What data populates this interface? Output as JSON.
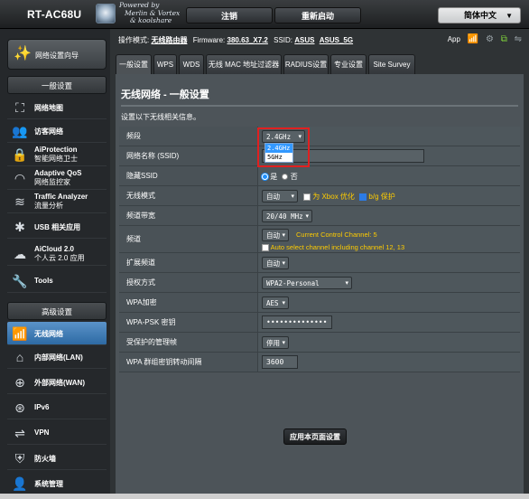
{
  "header": {
    "model": "RT-AC68U",
    "powered_line1": "Powered by",
    "powered_line2": "Merlin & Vortex",
    "powered_line3": "& koolshare",
    "logout": "注销",
    "reboot": "重新启动",
    "language": "简体中文"
  },
  "sidebar": {
    "qis_label": "网络设置向导",
    "general_header": "一般设置",
    "general_items": [
      {
        "label": "网络地图",
        "icon": "network-map-icon"
      },
      {
        "label": "访客网络",
        "icon": "guest-network-icon"
      },
      {
        "label": "AiProtection",
        "sub": "智能网络卫士",
        "icon": "aiprotection-icon"
      },
      {
        "label": "Adaptive QoS",
        "sub": "网络监控家",
        "icon": "qos-icon"
      },
      {
        "label": "Traffic Analyzer",
        "sub": "流量分析",
        "icon": "traffic-analyzer-icon"
      },
      {
        "label": "USB 相关应用",
        "icon": "usb-icon"
      },
      {
        "label": "AiCloud 2.0",
        "sub": "个人云 2.0 应用",
        "icon": "cloud-icon"
      },
      {
        "label": "Tools",
        "icon": "tools-icon"
      }
    ],
    "advanced_header": "高级设置",
    "advanced_items": [
      {
        "label": "无线网络",
        "icon": "wireless-icon",
        "active": true
      },
      {
        "label": "内部网络(LAN)",
        "icon": "lan-icon"
      },
      {
        "label": "外部网络(WAN)",
        "icon": "wan-icon"
      },
      {
        "label": "IPv6",
        "icon": "ipv6-icon"
      },
      {
        "label": "VPN",
        "icon": "vpn-icon"
      },
      {
        "label": "防火墙",
        "icon": "firewall-icon"
      },
      {
        "label": "系统管理",
        "icon": "admin-icon"
      }
    ]
  },
  "infobar": {
    "mode_label": "操作模式:",
    "mode_value": "无线路由器",
    "firmware_label": "Firmware:",
    "firmware_value": "380.63_X7.2",
    "ssid_label": "SSID:",
    "ssid1": "ASUS",
    "ssid2": "ASUS_5G",
    "app_label": "App"
  },
  "tabs": [
    "一般设置",
    "WPS",
    "WDS",
    "无线 MAC 地址过滤器",
    "RADIUS设置",
    "专业设置",
    "Site Survey"
  ],
  "panel": {
    "title": "无线网络 - 一般设置",
    "desc": "设置以下无线相关信息。"
  },
  "form": {
    "band_label": "频段",
    "band_value": "2.4GHz",
    "band_options": [
      "2.4GHz",
      "5GHz"
    ],
    "ssid_label": "网络名称 (SSID)",
    "hide_ssid_label": "隐藏SSID",
    "hide_yes": "是",
    "hide_no": "否",
    "mode_label": "无线模式",
    "mode_value": "自动",
    "xbox_label": "为 Xbox 优化",
    "bg_label": "b/g 保护",
    "bandwidth_label": "频道带宽",
    "bandwidth_value": "20/40 MHz",
    "channel_label": "频道",
    "channel_value": "自动",
    "channel_current": "Current Control Channel: 5",
    "channel_auto_text": "Auto select channel including channel 12, 13",
    "ext_channel_label": "扩展频道",
    "ext_channel_value": "自动",
    "auth_label": "授权方式",
    "auth_value": "WPA2-Personal",
    "wpa_enc_label": "WPA加密",
    "wpa_enc_value": "AES",
    "psk_label": "WPA-PSK 密钥",
    "psk_value": "••••••••••••••",
    "pmf_label": "受保护的管理帧",
    "pmf_value": "停用",
    "rekey_label": "WPA 群组密钥转动间隔",
    "rekey_value": "3600",
    "apply": "应用本页面设置"
  },
  "colors": {
    "active_menu": "#3a7ab8",
    "highlight": "#e02020",
    "note_yellow": "#ffcc00"
  }
}
